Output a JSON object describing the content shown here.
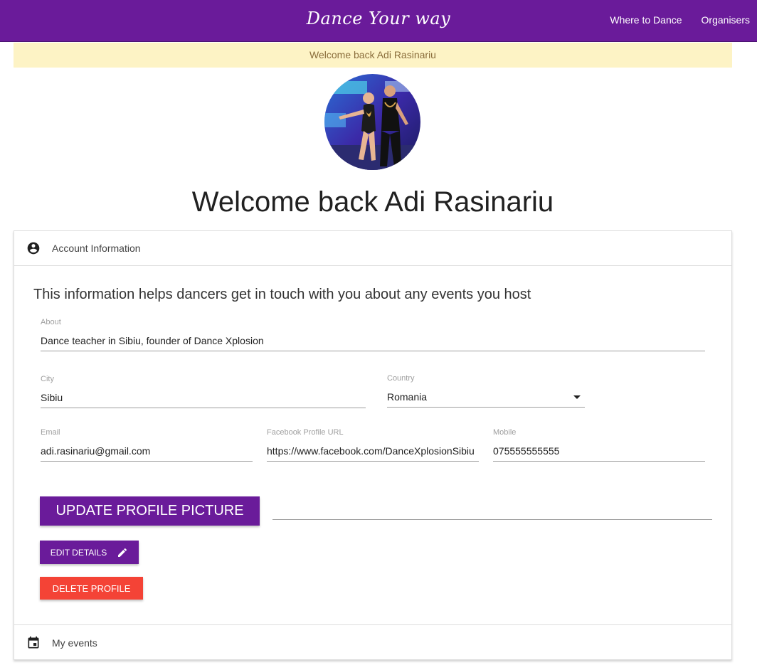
{
  "nav": {
    "brand": "Dance Your way",
    "links": [
      "Where to Dance",
      "Organisers"
    ],
    "background": "#6a1b9a"
  },
  "flash": {
    "message": "Welcome back Adi Rasinariu",
    "background": "#fdf3c5"
  },
  "profile": {
    "avatar_icon": "profile-photo-dancers",
    "title": "Welcome back Adi Rasinariu"
  },
  "account_section": {
    "header_icon": "account-circle-icon",
    "header": "Account Information",
    "intro": "This information helps dancers get in touch with you about any events you host",
    "fields": {
      "about": {
        "label": "About",
        "value": "Dance teacher in Sibiu, founder of Dance Xplosion"
      },
      "city": {
        "label": "City",
        "value": "Sibiu"
      },
      "country": {
        "label": "Country",
        "value": "Romania"
      },
      "email": {
        "label": "Email",
        "value": "adi.rasinariu@gmail.com"
      },
      "facebook": {
        "label": "Facebook Profile URL",
        "value": "https://www.facebook.com/DanceXplosionSibiu"
      },
      "mobile": {
        "label": "Mobile",
        "value": "075555555555"
      }
    },
    "buttons": {
      "upload": "Update profile picture",
      "edit": "Edit details",
      "edit_icon": "pencil-icon",
      "delete": "Delete profile"
    },
    "colors": {
      "primary": "#6a1b9a",
      "danger": "#f44336"
    }
  },
  "events_section": {
    "header_icon": "calendar-icon",
    "header": "My events"
  }
}
